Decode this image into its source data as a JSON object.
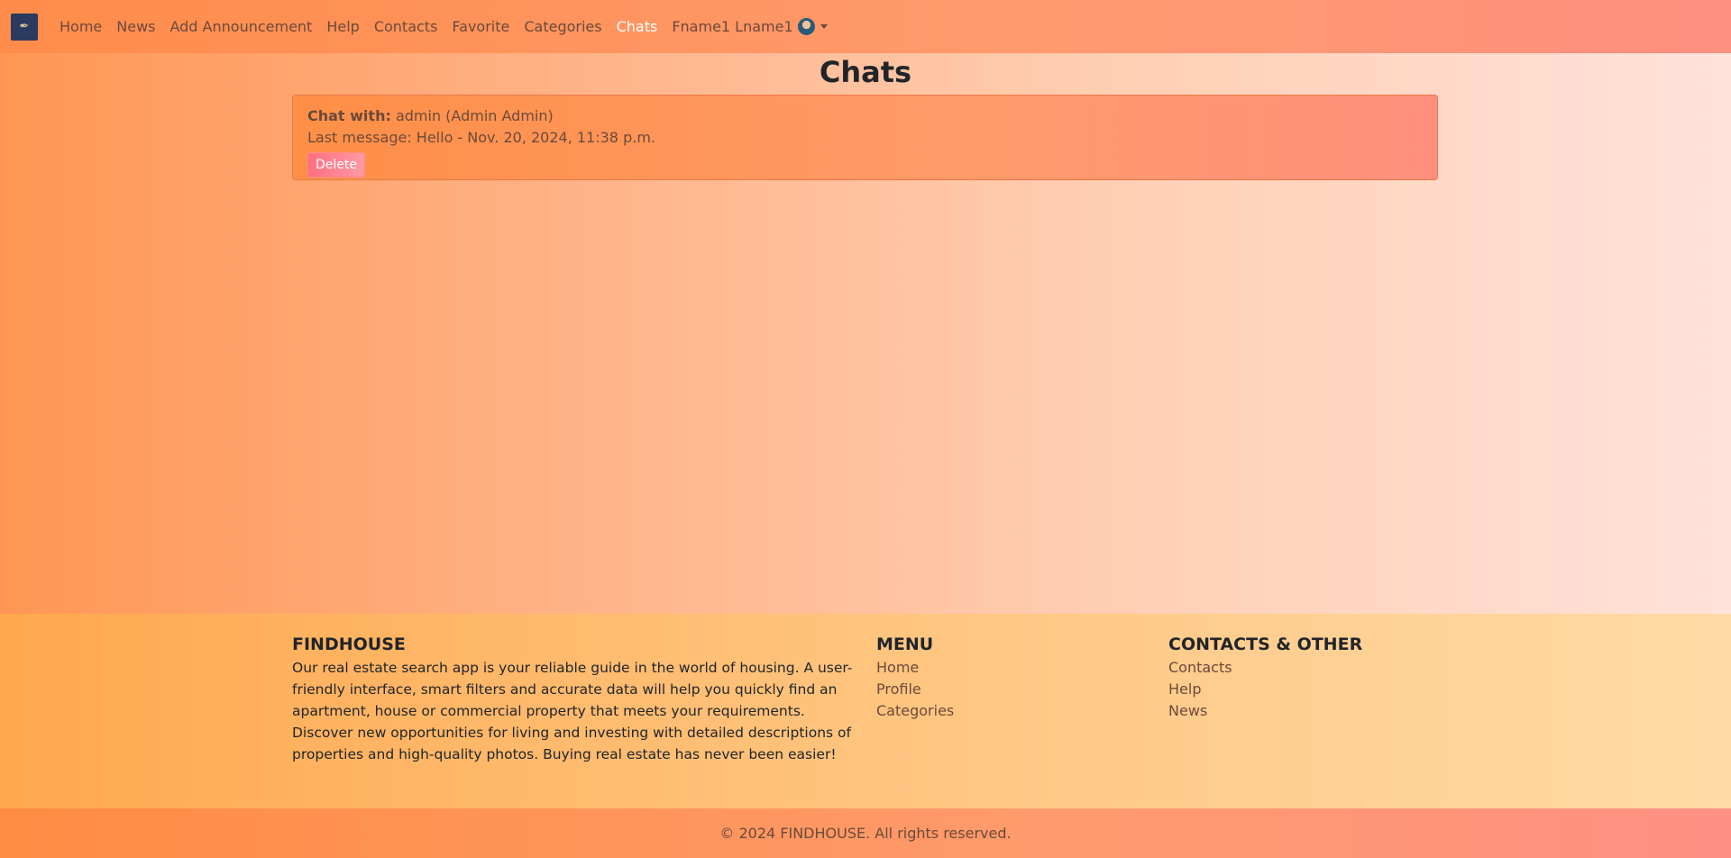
{
  "navbar": {
    "brand_icon": "house-quill-logo",
    "links": [
      {
        "label": "Home"
      },
      {
        "label": "News"
      },
      {
        "label": "Add Announcement"
      },
      {
        "label": "Help"
      },
      {
        "label": "Contacts"
      },
      {
        "label": "Favorite"
      },
      {
        "label": "Categories"
      },
      {
        "label": "Chats",
        "active": true
      }
    ],
    "user_name": "Fname1 Lname1"
  },
  "main": {
    "title": "Chats",
    "chats": [
      {
        "with_label": "Chat with:",
        "with_value": "admin (Admin Admin)",
        "last_message": "Last message: Hello - Nov. 20, 2024, 11:38 p.m.",
        "delete_label": "Delete"
      }
    ]
  },
  "footer": {
    "about": {
      "heading": "FINDHOUSE",
      "text": "Our real estate search app is your reliable guide in the world of housing. A user-friendly interface, smart filters and accurate data will help you quickly find an apartment, house or commercial property that meets your requirements. Discover new opportunities for living and investing with detailed descriptions of properties and high-quality photos. Buying real estate has never been easier!"
    },
    "menu": {
      "heading": "MENU",
      "links": [
        "Home",
        "Profile",
        "Categories"
      ]
    },
    "contacts": {
      "heading": "CONTACTS & OTHER",
      "links": [
        "Contacts",
        "Help",
        "News"
      ]
    },
    "copyright": "© 2024 FINDHOUSE. All rights reserved."
  },
  "colors": {
    "active_nav": "#ffffff",
    "link_text": "#6b4a3a",
    "delete_button": "#ff7f8a"
  }
}
